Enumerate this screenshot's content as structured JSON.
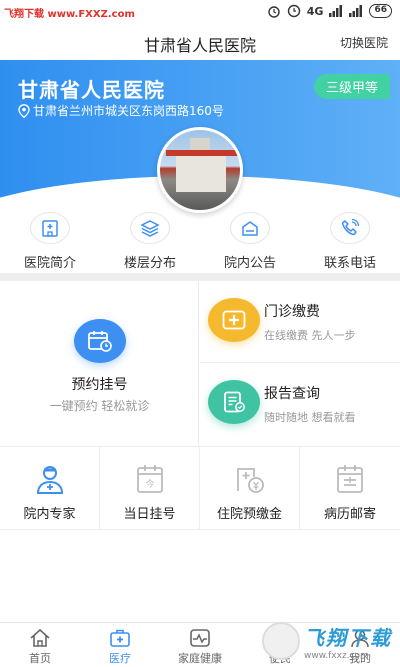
{
  "status": {
    "watermark": "飞翔下载 www.FXXZ.com",
    "network": "4G",
    "battery": "66"
  },
  "header": {
    "title": "甘肃省人民医院",
    "switch_label": "切换医院"
  },
  "hospital": {
    "name": "甘肃省人民医院",
    "address": "甘肃省兰州市城关区东岗西路160号",
    "level": "三级甲等"
  },
  "quick_nav": [
    {
      "label": "医院简介",
      "icon": "hospital-building-icon"
    },
    {
      "label": "楼层分布",
      "icon": "layers-icon"
    },
    {
      "label": "院内公告",
      "icon": "announcement-icon"
    },
    {
      "label": "联系电话",
      "icon": "phone-icon"
    }
  ],
  "services": {
    "appointment": {
      "title": "预约挂号",
      "subtitle": "一键预约 轻松就诊"
    },
    "payment": {
      "title": "门诊缴费",
      "subtitle": "在线缴费 先人一步"
    },
    "report": {
      "title": "报告查询",
      "subtitle": "随时随地 想看就看"
    }
  },
  "bottom_services": [
    {
      "label": "院内专家",
      "icon": "doctor-icon"
    },
    {
      "label": "当日挂号",
      "icon": "calendar-today-icon"
    },
    {
      "label": "住院预缴金",
      "icon": "deposit-icon"
    },
    {
      "label": "病历邮寄",
      "icon": "medical-record-icon"
    }
  ],
  "tabs": [
    {
      "label": "首页",
      "icon": "home-icon"
    },
    {
      "label": "医疗",
      "icon": "medical-kit-icon"
    },
    {
      "label": "家庭健康",
      "icon": "health-pulse-icon"
    },
    {
      "label": "便民",
      "icon": "convenience-icon"
    },
    {
      "label": "我的",
      "icon": "user-icon"
    }
  ],
  "overlay_watermark": {
    "main": "飞翔下载",
    "url": "www.fxxz.com"
  },
  "colors": {
    "primary": "#3d8ff2",
    "level_badge": "#42d1a3",
    "payment": "#f5b92d",
    "report": "#3fc3a3"
  }
}
